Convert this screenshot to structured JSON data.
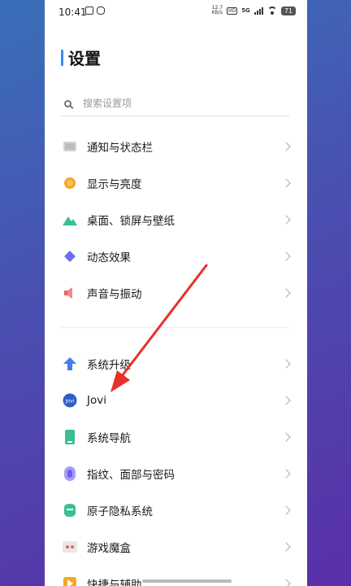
{
  "status_bar": {
    "time": "10:41",
    "net_speed_value": "12.7",
    "net_speed_unit": "KB/s",
    "hd_label": "HD",
    "network": "5G",
    "battery": "71"
  },
  "page_title": "设置",
  "search": {
    "placeholder": "搜索设置项"
  },
  "group1": [
    {
      "label": "通知与状态栏",
      "icon": "notification-icon",
      "color": "#b8b8b8"
    },
    {
      "label": "显示与亮度",
      "icon": "brightness-icon",
      "color": "#f5a623"
    },
    {
      "label": "桌面、锁屏与壁纸",
      "icon": "wallpaper-icon",
      "color": "#3bbf8f"
    },
    {
      "label": "动态效果",
      "icon": "effects-icon",
      "color": "#6a6ef0"
    },
    {
      "label": "声音与振动",
      "icon": "sound-icon",
      "color": "#f06464"
    }
  ],
  "group2": [
    {
      "label": "系统升级",
      "icon": "upgrade-icon",
      "color": "#4a7bef"
    },
    {
      "label": "Jovi",
      "icon": "jovi-icon",
      "color": "#2d5ec8"
    },
    {
      "label": "系统导航",
      "icon": "navigation-icon",
      "color": "#3bbf8f"
    },
    {
      "label": "指纹、面部与密码",
      "icon": "fingerprint-icon",
      "color": "#7b6ff0"
    },
    {
      "label": "原子隐私系统",
      "icon": "privacy-icon",
      "color": "#3bbf8f"
    },
    {
      "label": "游戏魔盒",
      "icon": "game-icon",
      "color": "#d86a6a"
    },
    {
      "label": "快捷与辅助",
      "icon": "shortcut-icon",
      "color": "#f5a623"
    }
  ],
  "colors": {
    "accent": "#3b8cf0",
    "arrow": "#e8302a"
  }
}
